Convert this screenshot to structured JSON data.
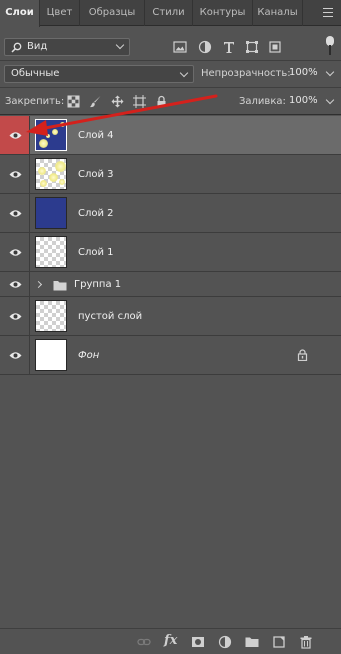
{
  "tabs": [
    {
      "label": "Слои"
    },
    {
      "label": "Цвет"
    },
    {
      "label": "Образцы"
    },
    {
      "label": "Стили"
    },
    {
      "label": "Контуры"
    },
    {
      "label": "Каналы"
    }
  ],
  "filter": {
    "label": "Вид"
  },
  "blend": {
    "mode": "Обычные",
    "opacity_label": "Непрозрачность:",
    "opacity_value": "100%"
  },
  "lock": {
    "label": "Закрепить:",
    "fill_label": "Заливка:",
    "fill_value": "100%"
  },
  "layers": [
    {
      "name": "Слой 4"
    },
    {
      "name": "Слой 3"
    },
    {
      "name": "Слой 2"
    },
    {
      "name": "Слой 1"
    },
    {
      "name": "Группа 1"
    },
    {
      "name": "пустой слой"
    },
    {
      "name": "Фон"
    }
  ],
  "footer": {
    "fx_label": "fx"
  },
  "colors": {
    "panel": "#535353",
    "selected_row": "#6b6b6b",
    "eye_highlight": "#c24a4a",
    "annotation_arrow": "#e0201c",
    "layer_blue": "#2c3b8e"
  }
}
